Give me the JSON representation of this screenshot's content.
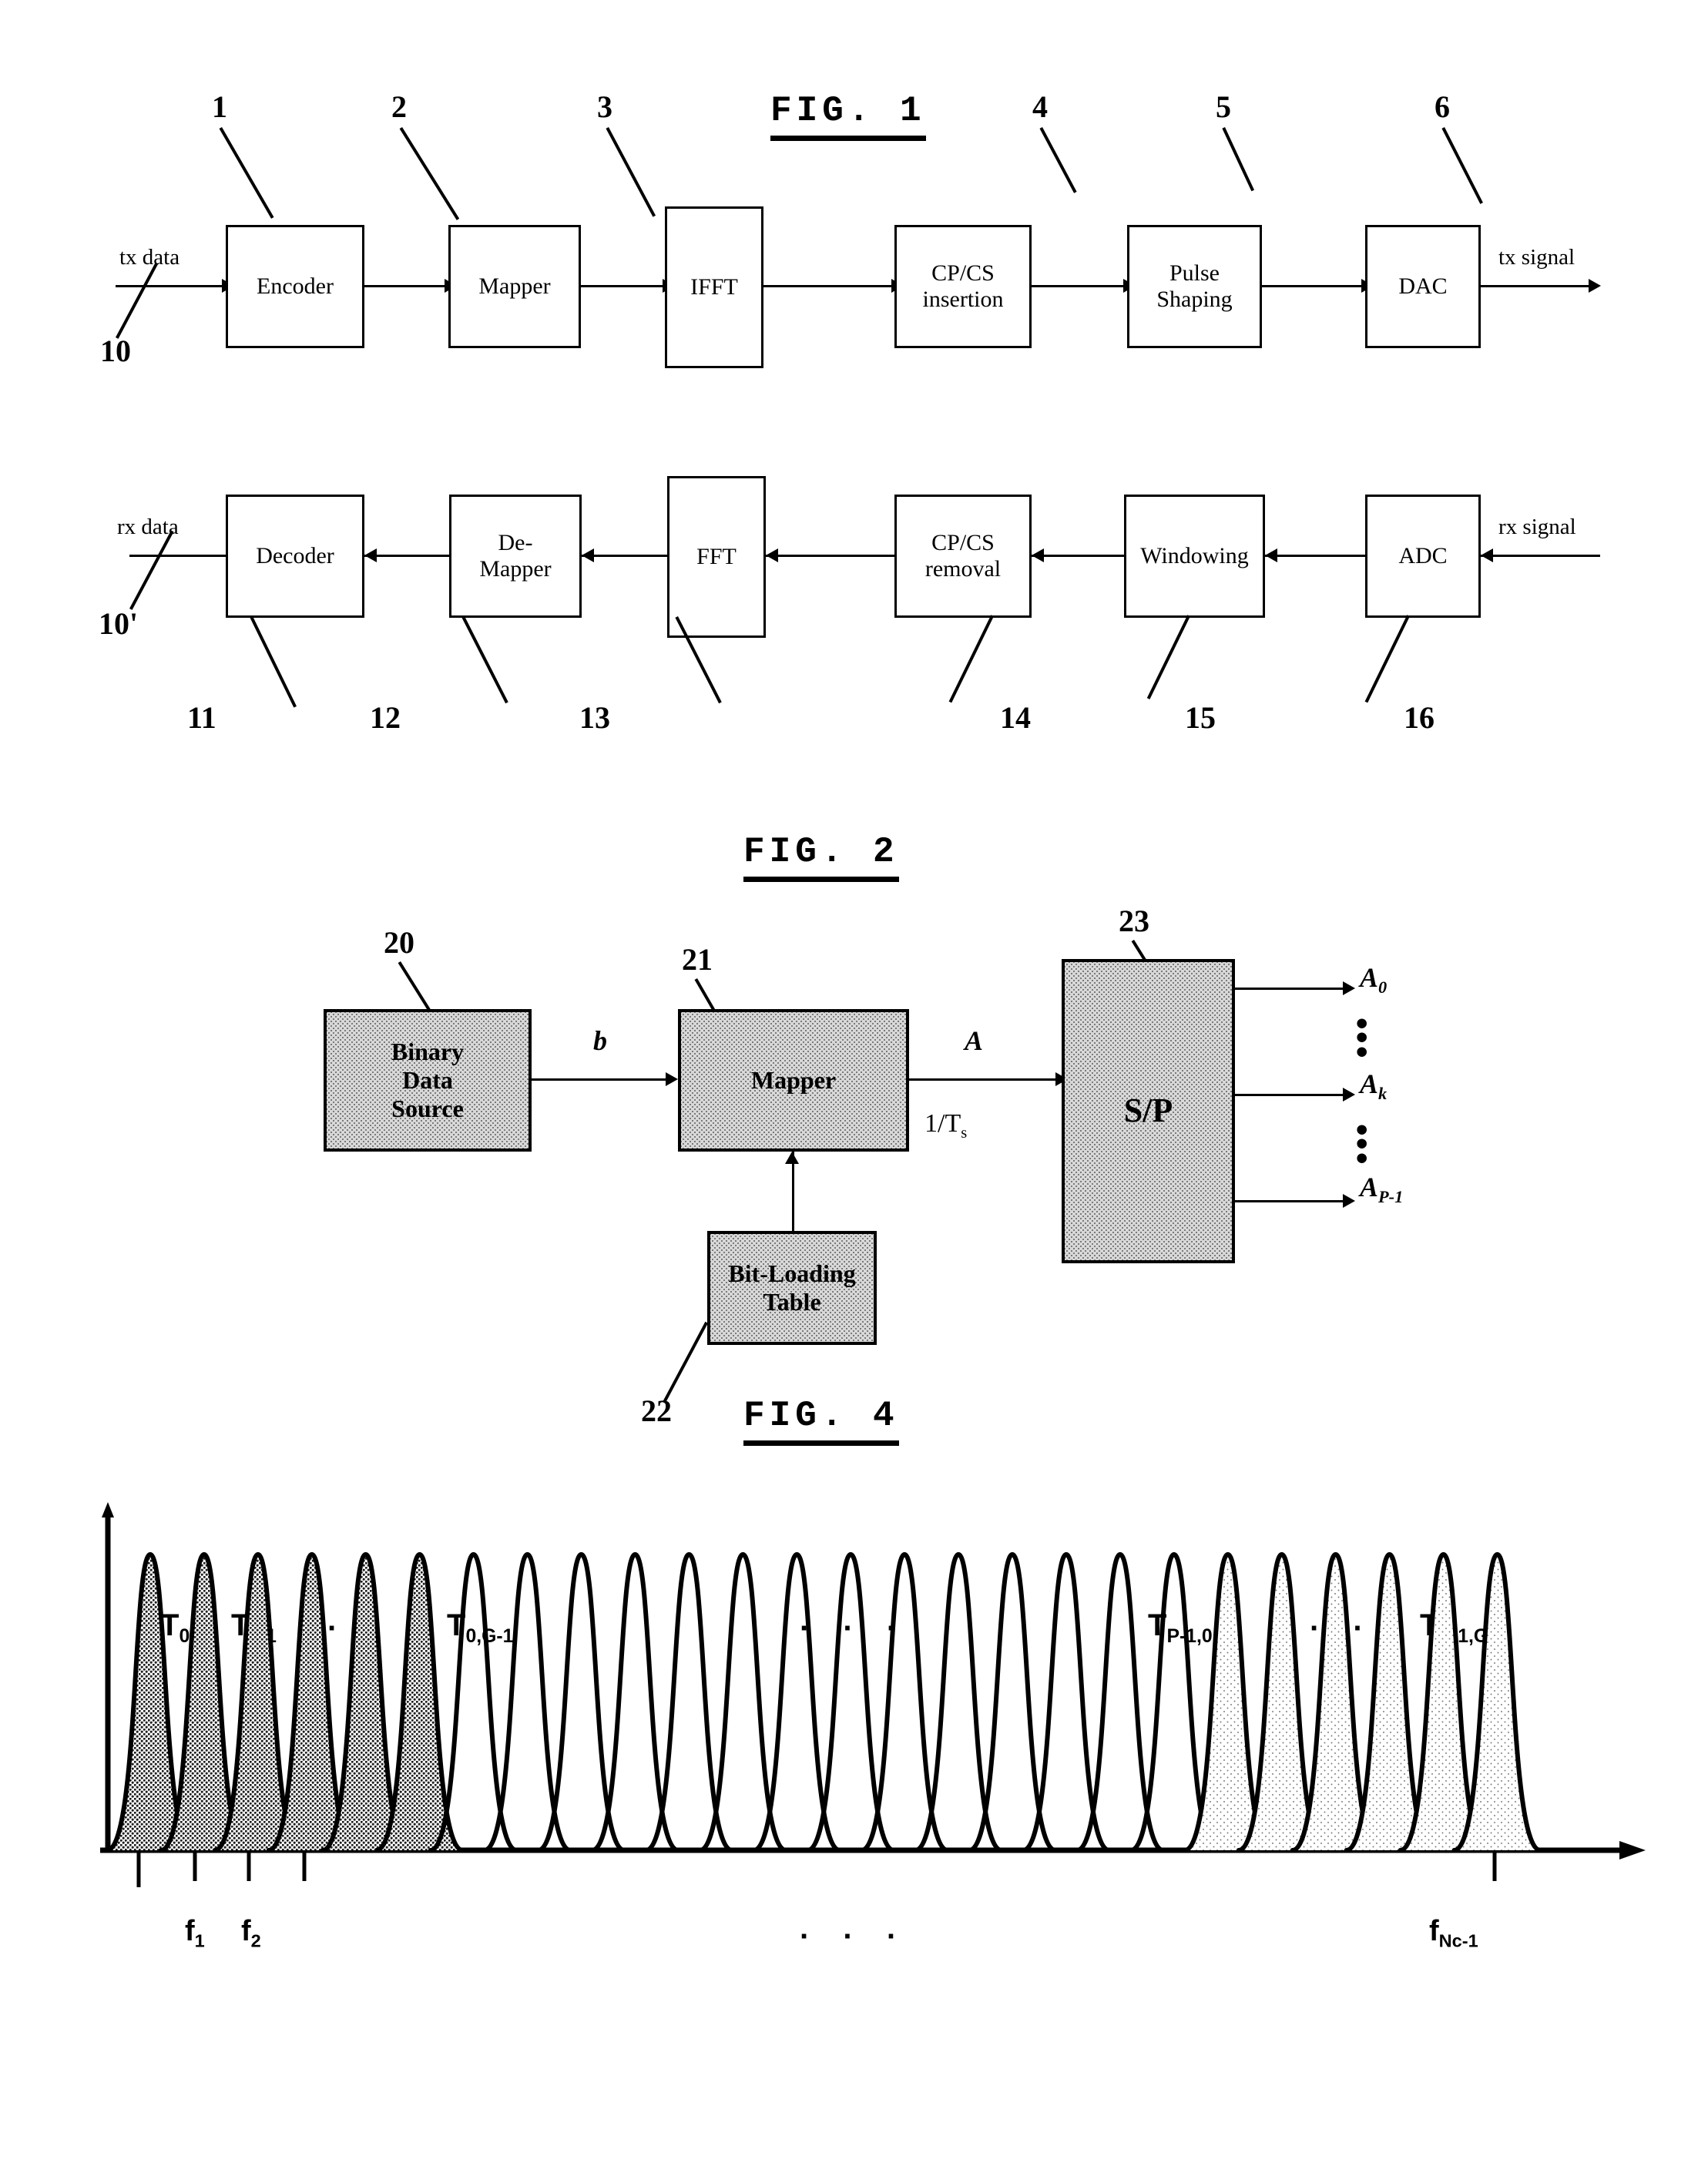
{
  "figures": {
    "fig1": {
      "caption": "FIG. 1",
      "tx_chain": {
        "input_label": "tx data",
        "output_label": "tx signal",
        "chain_ref": "10",
        "blocks": [
          {
            "label": "Encoder",
            "ref": "1"
          },
          {
            "label": "Mapper",
            "ref": "2"
          },
          {
            "label": "IFFT",
            "ref": "3"
          },
          {
            "label_line1": "CP/CS",
            "label_line2": "insertion",
            "ref": "4"
          },
          {
            "label_line1": "Pulse",
            "label_line2": "Shaping",
            "ref": "5"
          },
          {
            "label": "DAC",
            "ref": "6"
          }
        ]
      },
      "rx_chain": {
        "input_label": "rx signal",
        "output_label": "rx data",
        "chain_ref": "10'",
        "blocks": [
          {
            "label": "Decoder",
            "ref": "11"
          },
          {
            "label_line1": "De-",
            "label_line2": "Mapper",
            "ref": "12"
          },
          {
            "label": "FFT",
            "ref": "13"
          },
          {
            "label_line1": "CP/CS",
            "label_line2": "removal",
            "ref": "14"
          },
          {
            "label": "Windowing",
            "ref": "15"
          },
          {
            "label": "ADC",
            "ref": "16"
          }
        ]
      }
    },
    "fig2": {
      "caption": "FIG. 2",
      "blocks": [
        {
          "label_line1": "Binary",
          "label_line2": "Data",
          "label_line3": "Source",
          "ref": "20"
        },
        {
          "label": "Mapper",
          "ref": "21"
        },
        {
          "label_line1": "Bit-Loading",
          "label_line2": "Table",
          "ref": "22"
        },
        {
          "label": "S/P",
          "ref": "23"
        }
      ],
      "signal_b": "b",
      "signal_A": "A",
      "rate": "1/T",
      "rate_sub": "s",
      "outputs": [
        {
          "base": "A",
          "sub": "0"
        },
        {
          "base": "A",
          "sub": "k"
        },
        {
          "base": "A",
          "sub": "P-1"
        }
      ],
      "dots": "•\n•\n•"
    },
    "fig4": {
      "caption": "FIG. 4",
      "group_labels": [
        {
          "base": "T",
          "sub": "0,0"
        },
        {
          "base": "T",
          "sub": "0,1"
        },
        {
          "base": "T",
          "sub": "0,G-1"
        },
        {
          "base": "T",
          "sub": "P-1,0"
        },
        {
          "base": "T",
          "sub": "P-1,G-1"
        }
      ],
      "ellipsis": "·  ·  ·",
      "axis_labels": [
        {
          "base": "f",
          "sub": "1"
        },
        {
          "base": "f",
          "sub": "2"
        },
        {
          "base": "f",
          "sub": "Nc-1"
        }
      ]
    }
  },
  "chart_data": {
    "type": "line",
    "title": "FIG. 4",
    "xlabel": "",
    "ylabel": "",
    "description": "Overlapping raised-cosine subcarrier spectra; 26 lobes total. Lobes 1-6 are dark shaded (group T0,*), lobes 7-20 are unshaded, lobes 21-26 are light shaded (group TP-1,*).",
    "n_lobes": 26,
    "shading": [
      "dark",
      "dark",
      "dark",
      "dark",
      "dark",
      "dark",
      "none",
      "none",
      "none",
      "none",
      "none",
      "none",
      "none",
      "none",
      "none",
      "none",
      "none",
      "none",
      "none",
      "none",
      "light",
      "light",
      "light",
      "light",
      "light",
      "light"
    ],
    "lobe_peak": 1.0,
    "x_ticks": [
      1,
      2,
      24
    ],
    "x_tick_labels": [
      "f1",
      "f2",
      "fNc-1"
    ],
    "grid": false,
    "legend": "none",
    "annotations": [
      "T0,0",
      "T0,1",
      "T0,G-1",
      "TP-1,0",
      "TP-1,G-1"
    ]
  }
}
